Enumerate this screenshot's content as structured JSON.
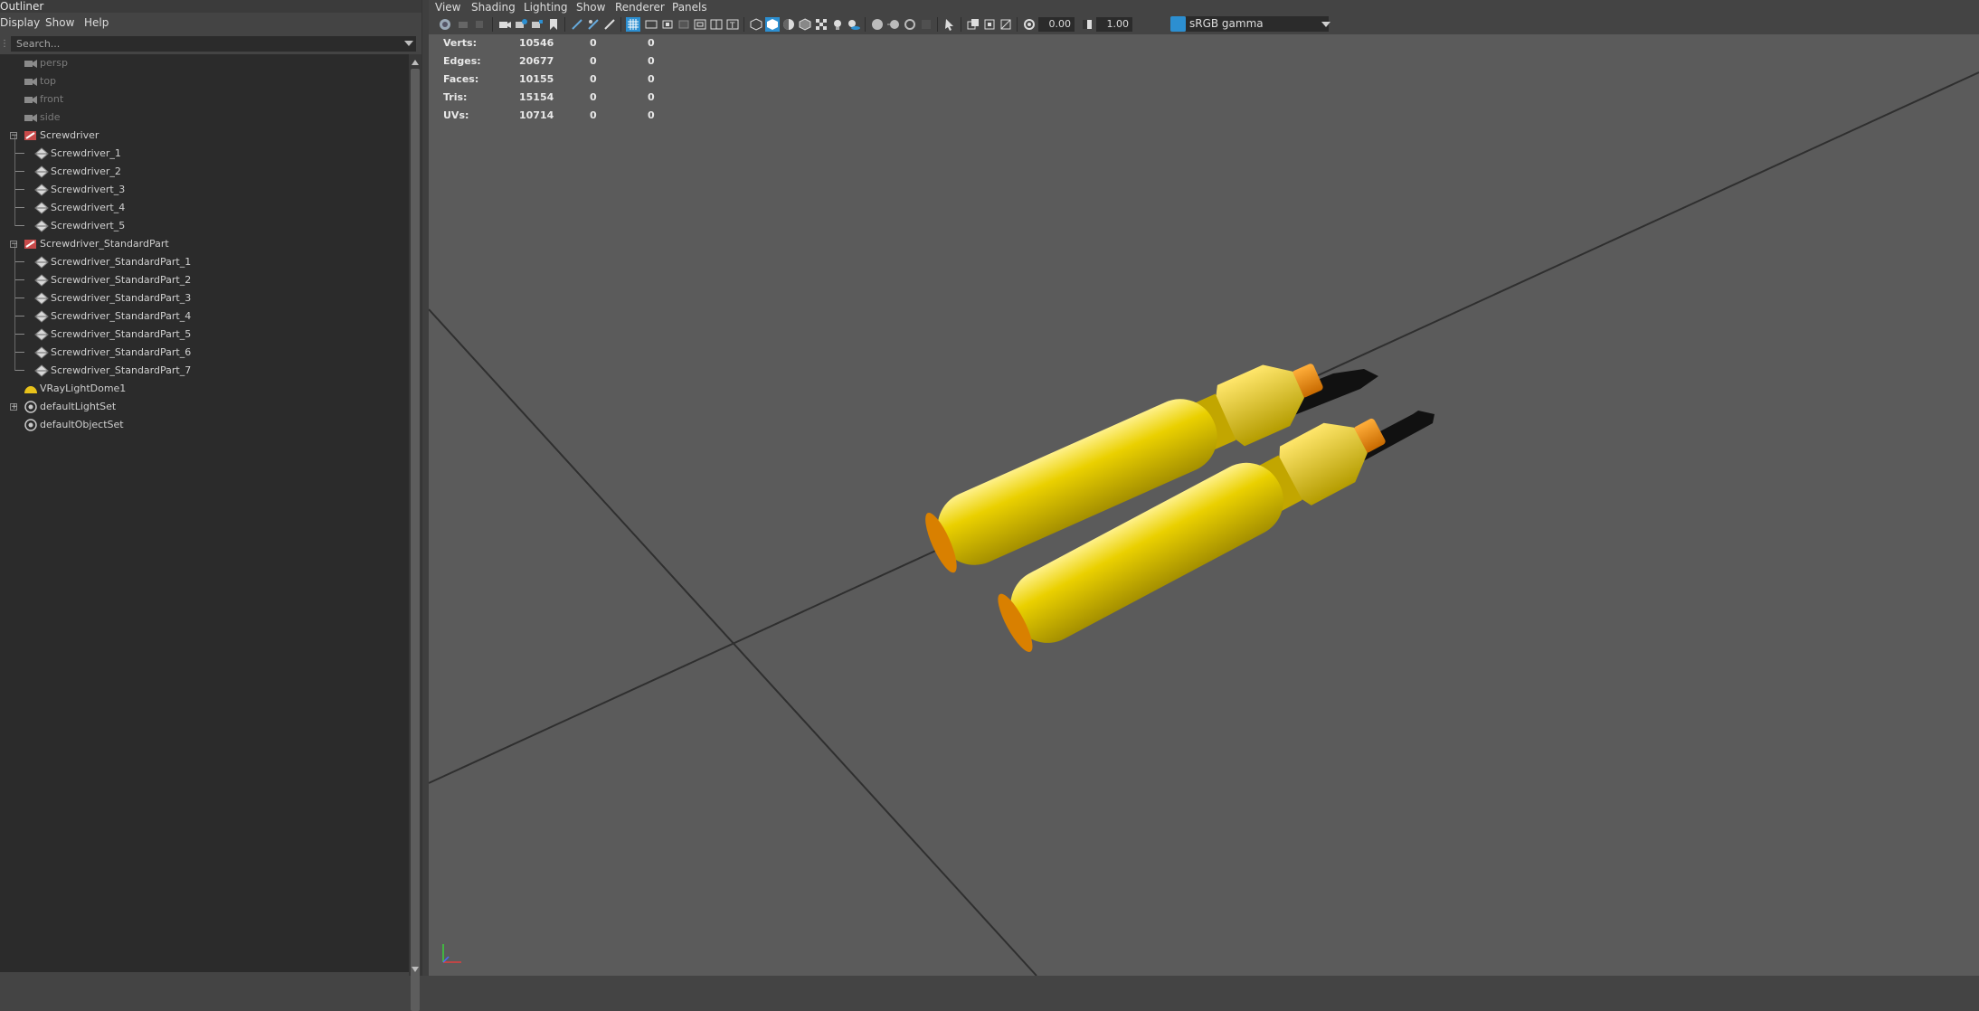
{
  "outliner": {
    "title": "Outliner",
    "menu": [
      "Display",
      "Show",
      "Help"
    ],
    "search_placeholder": "Search...",
    "items": [
      {
        "label": "persp",
        "icon": "camera-icon",
        "indent": 0,
        "dim": true
      },
      {
        "label": "top",
        "icon": "camera-icon",
        "indent": 0,
        "dim": true
      },
      {
        "label": "front",
        "icon": "camera-icon",
        "indent": 0,
        "dim": true
      },
      {
        "label": "side",
        "icon": "camera-icon",
        "indent": 0,
        "dim": true
      },
      {
        "label": "Screwdriver",
        "icon": "group-icon",
        "indent": 0,
        "expander": "collapse"
      },
      {
        "label": "Screwdriver_1",
        "icon": "mesh-icon",
        "indent": 1
      },
      {
        "label": "Screwdriver_2",
        "icon": "mesh-icon",
        "indent": 1
      },
      {
        "label": "Screwdrivert_3",
        "icon": "mesh-icon",
        "indent": 1
      },
      {
        "label": "Screwdrivert_4",
        "icon": "mesh-icon",
        "indent": 1
      },
      {
        "label": "Screwdrivert_5",
        "icon": "mesh-icon",
        "indent": 1
      },
      {
        "label": "Screwdriver_StandardPart",
        "icon": "group-icon",
        "indent": 0,
        "expander": "collapse"
      },
      {
        "label": "Screwdriver_StandardPart_1",
        "icon": "mesh-icon",
        "indent": 1
      },
      {
        "label": "Screwdriver_StandardPart_2",
        "icon": "mesh-icon",
        "indent": 1
      },
      {
        "label": "Screwdriver_StandardPart_3",
        "icon": "mesh-icon",
        "indent": 1
      },
      {
        "label": "Screwdriver_StandardPart_4",
        "icon": "mesh-icon",
        "indent": 1
      },
      {
        "label": "Screwdriver_StandardPart_5",
        "icon": "mesh-icon",
        "indent": 1
      },
      {
        "label": "Screwdriver_StandardPart_6",
        "icon": "mesh-icon",
        "indent": 1
      },
      {
        "label": "Screwdriver_StandardPart_7",
        "icon": "mesh-icon",
        "indent": 1
      },
      {
        "label": "VRayLightDome1",
        "icon": "light-dome-icon",
        "indent": 0
      },
      {
        "label": "defaultLightSet",
        "icon": "set-icon",
        "indent": 0,
        "expander": "expand"
      },
      {
        "label": "defaultObjectSet",
        "icon": "set-icon",
        "indent": 0
      }
    ]
  },
  "viewport": {
    "menu": [
      "View",
      "Shading",
      "Lighting",
      "Show",
      "Renderer",
      "Panels"
    ],
    "toolbar": {
      "exposure": "0.00",
      "gamma": "1.00",
      "color_space": "sRGB gamma",
      "accent": "#2c8fd1"
    },
    "hud": [
      {
        "label": "Verts:",
        "values": [
          "10546",
          "0",
          "0"
        ]
      },
      {
        "label": "Edges:",
        "values": [
          "20677",
          "0",
          "0"
        ]
      },
      {
        "label": "Faces:",
        "values": [
          "10155",
          "0",
          "0"
        ]
      },
      {
        "label": "Tris:",
        "values": [
          "15154",
          "0",
          "0"
        ]
      },
      {
        "label": "UVs:",
        "values": [
          "10714",
          "0",
          "0"
        ]
      }
    ],
    "colors": {
      "background": "#5b5b5b",
      "handle": "#e3c400",
      "ferrule": "#f08a00",
      "shaft": "#111111",
      "grid": "#2f2f2f"
    }
  }
}
